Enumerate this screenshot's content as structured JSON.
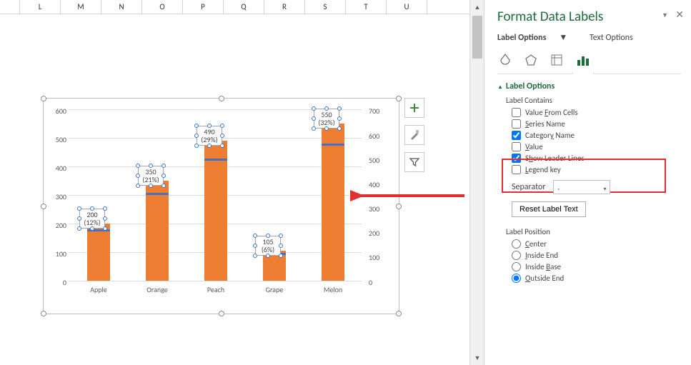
{
  "columns": [
    "L",
    "M",
    "N",
    "O",
    "P",
    "Q",
    "R",
    "S",
    "T",
    "U"
  ],
  "chart_data": {
    "type": "bar",
    "categories": [
      "Apple",
      "Orange",
      "Peach",
      "Grape",
      "Melon"
    ],
    "values": [
      200,
      350,
      490,
      105,
      550
    ],
    "pct_labels": [
      "(12%)",
      "(21%)",
      "(29%)",
      "(6%)",
      "(32%)"
    ],
    "ylim": [
      0,
      600
    ],
    "y_ticks": [
      0,
      100,
      200,
      300,
      400,
      500,
      600
    ],
    "y2_ticks": [
      0,
      100,
      200,
      300,
      400,
      500,
      600,
      700
    ]
  },
  "pane": {
    "title": "Format Data Labels",
    "tab_label_options": "Label Options",
    "tab_text_options": "Text Options",
    "section_label_options": "Label Options",
    "label_contains": "Label Contains",
    "opt_value_from_cells": "Value From Cells",
    "opt_series_name": "Series Name",
    "opt_category_name": "Category Name",
    "opt_value": "Value",
    "opt_show_leader": "Show Leader Lines",
    "opt_legend_key": "Legend key",
    "separator_label": "Separator",
    "separator_value": ",",
    "reset_btn": "Reset Label Text",
    "label_position": "Label Position",
    "pos_center": "Center",
    "pos_inside_end": "Inside End",
    "pos_inside_base": "Inside Base",
    "pos_outside_end": "Outside End",
    "checked": {
      "category_name": true,
      "value": false,
      "show_leader": true
    },
    "pos_checked": "outside_end"
  }
}
